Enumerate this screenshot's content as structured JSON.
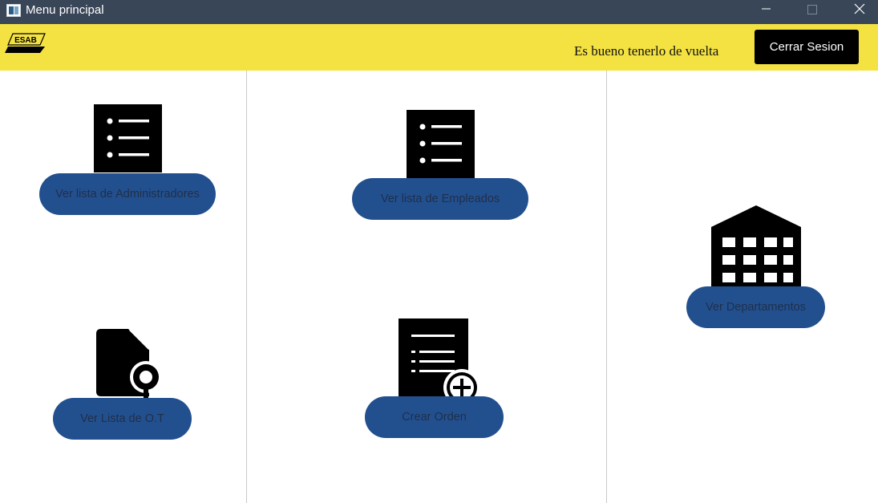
{
  "window": {
    "title": "Menu principal",
    "controls": {
      "minimize": "minimize-icon",
      "maximize": "maximize-icon",
      "close": "close-icon"
    }
  },
  "header": {
    "logo_text": "ESAB",
    "welcome": "Es bueno tenerlo de vuelta",
    "logout_label": "Cerrar Sesion"
  },
  "menu": {
    "admins": {
      "label": "Ver lista de Administradores",
      "icon": "list-icon"
    },
    "employees": {
      "label": "Ver lista de Empleados",
      "icon": "list-icon"
    },
    "departments": {
      "label": "Ver Departamentos",
      "icon": "building-icon"
    },
    "work_orders": {
      "label": "Ver Lista de O.T",
      "icon": "file-search-icon"
    },
    "create_order": {
      "label": "Crear Orden",
      "icon": "document-add-icon"
    }
  },
  "colors": {
    "titlebar": "#394658",
    "header": "#f4e242",
    "button": "#22508f",
    "logout": "#000000"
  }
}
